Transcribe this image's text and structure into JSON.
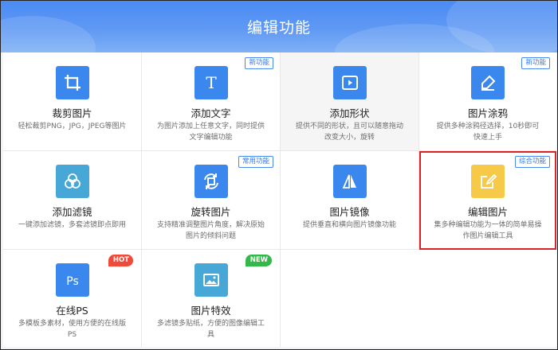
{
  "header": {
    "title": "编辑功能"
  },
  "colors": {
    "primary": "#4a8af3",
    "hot": "#f04a3a",
    "new": "#35b84a",
    "selected": "#d9232b"
  },
  "cards": [
    {
      "title": "裁剪图片",
      "desc": "轻松裁剪PNG，JPG，JPEG等图片",
      "icon": "crop-icon",
      "color": "#3a88ee",
      "tag": "",
      "badge": ""
    },
    {
      "title": "添加文字",
      "desc": "为图片添加上任意文字，同时提供文字编辑功能",
      "icon": "text-icon",
      "color": "#3a88ee",
      "tag": "新功能",
      "badge": ""
    },
    {
      "title": "添加形状",
      "desc": "提供不同的形状，且可以随意拖动改变大小，旋转",
      "icon": "play-shape-icon",
      "color": "#3a88ee",
      "tag": "",
      "badge": ""
    },
    {
      "title": "图片涂鸦",
      "desc": "提供多种涂鸦径选择，10秒即可快速上手",
      "icon": "pen-icon",
      "color": "#3a88ee",
      "tag": "新功能",
      "badge": ""
    },
    {
      "title": "添加滤镜",
      "desc": "一键添加滤镜，多套滤镜即点即用",
      "icon": "filter-icon",
      "color": "#47a8d8",
      "tag": "",
      "badge": ""
    },
    {
      "title": "旋转图片",
      "desc": "支持精准调整图片角度，解决原始图片的倾斜问题",
      "icon": "rotate-icon",
      "color": "#3a88ee",
      "tag": "常用功能",
      "badge": ""
    },
    {
      "title": "图片镜像",
      "desc": "提供垂直和横向图片镜像功能",
      "icon": "mirror-icon",
      "color": "#3a88ee",
      "tag": "",
      "badge": ""
    },
    {
      "title": "编辑图片",
      "desc": "集多种编辑功能为一体的简单易操作图片编辑工具",
      "icon": "edit-icon",
      "color": "#f7c948",
      "tag": "综合功能",
      "badge": ""
    },
    {
      "title": "在线PS",
      "desc": "多模板多素材，使用方便的在线版PS",
      "icon": "ps-icon",
      "color": "#3a88ee",
      "tag": "",
      "badge": "HOT"
    },
    {
      "title": "图片特效",
      "desc": "多滤镜多贴纸，方便的图像编辑工具",
      "icon": "image-effect-icon",
      "color": "#47a8d8",
      "tag": "",
      "badge": "NEW"
    }
  ]
}
